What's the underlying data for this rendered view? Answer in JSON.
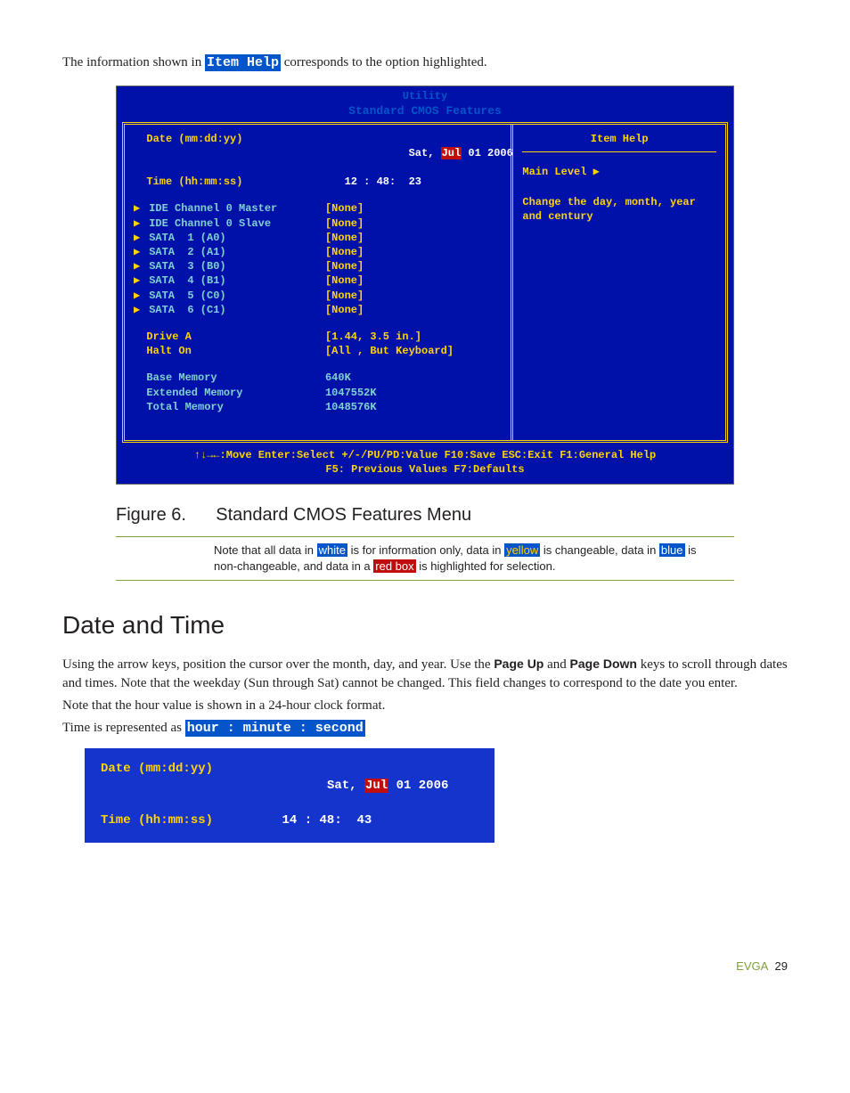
{
  "intro": {
    "prefix": "The information shown in ",
    "token": "Item Help",
    "suffix": " corresponds to the option highlighted."
  },
  "bios": {
    "header_top": "Utility",
    "header_sub": "Standard CMOS Features",
    "date_label": "  Date (mm:dd:yy)",
    "date_value_prefix": "   Sat, ",
    "date_value_sel": "Jul",
    "date_value_suffix": " 01 2006",
    "time_label": "  Time (hh:mm:ss)",
    "time_value": "   12 : 48:  23",
    "rows": [
      {
        "arrow": "▶",
        "label": "IDE Channel 0 Master",
        "value": "[None]"
      },
      {
        "arrow": "▶",
        "label": "IDE Channel 0 Slave",
        "value": "[None]"
      },
      {
        "arrow": "▶",
        "label": "SATA  1 (A0)",
        "value": "[None]"
      },
      {
        "arrow": "▶",
        "label": "SATA  2 (A1)",
        "value": "[None]"
      },
      {
        "arrow": "▶",
        "label": "SATA  3 (B0)",
        "value": "[None]"
      },
      {
        "arrow": "▶",
        "label": "SATA  4 (B1)",
        "value": "[None]"
      },
      {
        "arrow": "▶",
        "label": "SATA  5 (C0)",
        "value": "[None]"
      },
      {
        "arrow": "▶",
        "label": "SATA  6 (C1)",
        "value": "[None]"
      }
    ],
    "drivea_label": "  Drive A",
    "drivea_value": "[1.44, 3.5 in.]",
    "halton_label": "  Halt On",
    "halton_value": "[All , But Keyboard]",
    "mem": [
      {
        "label": "  Base Memory",
        "value": "640K"
      },
      {
        "label": "  Extended Memory",
        "value": "1047552K"
      },
      {
        "label": "  Total Memory",
        "value": "1048576K"
      }
    ],
    "help_title": "Item Help",
    "help_level": "Main Level   ▶",
    "help_text": "Change the day, month, year and century",
    "footer_line1": "↑↓→←:Move  Enter:Select  +/-/PU/PD:Value  F10:Save  ESC:Exit  F1:General Help",
    "footer_line2": "F5: Previous Values       F7:Defaults"
  },
  "figure": {
    "label": "Figure 6.",
    "title": "Standard CMOS Features Menu"
  },
  "note": {
    "p1": "Note that all data in ",
    "white": "white",
    "p2": " is for information only, data in ",
    "yellow": "yellow",
    "p3": " is changeable, data in ",
    "blue": "blue",
    "p4": " is non-changeable, and data in a ",
    "redbox": "red box",
    "p5": " is highlighted for selection."
  },
  "sec_heading": "Date and Time",
  "para1": {
    "a": "Using the arrow keys, position the cursor over the month, day, and year. Use the ",
    "pageup": "Page Up",
    "b": " and ",
    "pagedown": "Page Down",
    "c": " keys to scroll through dates and times. Note that the weekday (Sun through Sat) cannot be changed. This field changes to correspond to the date you enter."
  },
  "para2": "Note that the hour value is shown in a 24-hour clock format.",
  "para3": {
    "a": "Time is represented as ",
    "code": "hour : minute : second"
  },
  "dtbox": {
    "date_label": "Date (mm:dd:yy)",
    "date_value_prefix": "Sat, ",
    "date_value_sel": "Jul",
    "date_value_suffix": " 01 2006",
    "time_label": "Time (hh:mm:ss)",
    "time_value": "14 : 48:  43"
  },
  "footer": {
    "brand": "EVGA",
    "page": "29"
  }
}
